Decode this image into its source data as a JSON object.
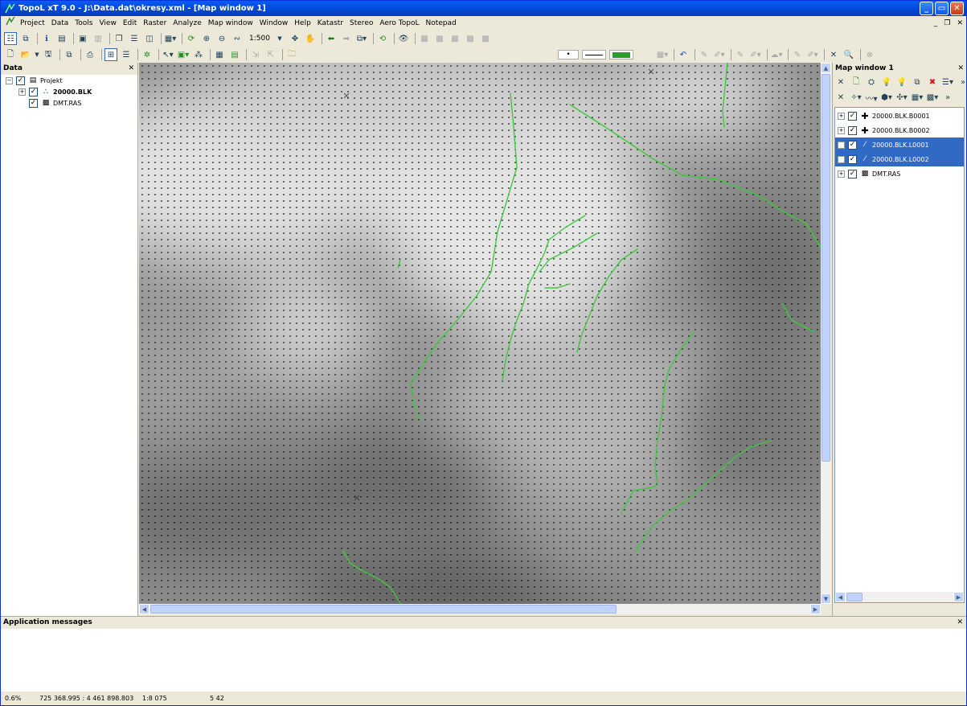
{
  "window": {
    "title": "TopoL xT 9.0 - J:\\Data.dat\\okresy.xml - [Map window 1]"
  },
  "menu": [
    "Project",
    "Data",
    "Tools",
    "View",
    "Edit",
    "Raster",
    "Analyze",
    "Map window",
    "Window",
    "Help",
    "Katastr",
    "Stereo",
    "Aero TopoL",
    "Notepad"
  ],
  "toolbar": {
    "scale": "1:500"
  },
  "data_panel": {
    "title": "Data",
    "items": [
      {
        "label": "Projekt"
      },
      {
        "label": "20000.BLK"
      },
      {
        "label": "DMT.RAS"
      }
    ]
  },
  "map_window_panel": {
    "title": "Map window 1",
    "layers": [
      {
        "label": "20000.BLK.B0001",
        "selected": false,
        "icon": "point-layer-icon"
      },
      {
        "label": "20000.BLK.B0002",
        "selected": false,
        "icon": "point-layer-icon"
      },
      {
        "label": "20000.BLK.L0001",
        "selected": true,
        "icon": "line-layer-icon"
      },
      {
        "label": "20000.BLK.L0002",
        "selected": true,
        "icon": "line-layer-icon"
      },
      {
        "label": "DMT.RAS",
        "selected": false,
        "icon": "raster-layer-icon"
      }
    ]
  },
  "messages": {
    "title": "Application messages"
  },
  "status": {
    "zoom": "0.6%",
    "coords": "725 368.995 : 4 461 898.803",
    "scale": "1:8 075",
    "extra": "5 42"
  },
  "colors": {
    "accent": "#316ac5",
    "line": "#3fc83f",
    "title": "#0046d5"
  }
}
